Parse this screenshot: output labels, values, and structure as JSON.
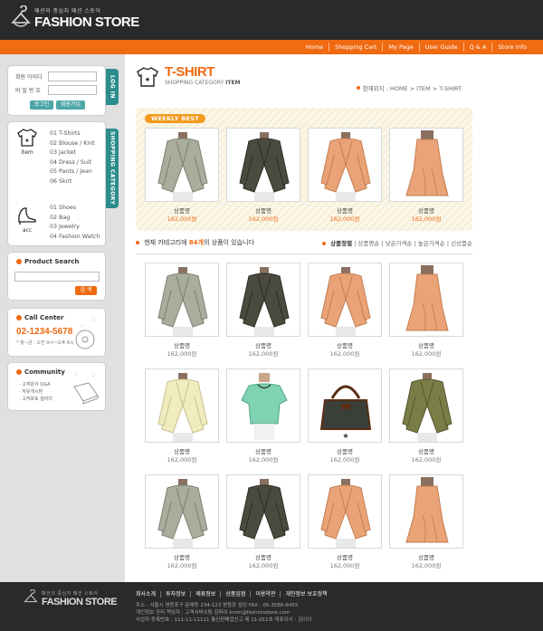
{
  "header": {
    "logo_sub": "패션의 중심지 패션 스토어",
    "logo_main": "FASHION STORE",
    "nav": [
      "Home",
      "Shopping Cart",
      "My Page",
      "User Guide",
      "Q & A",
      "Store Info"
    ]
  },
  "login": {
    "id_label": "회원 아이디",
    "pw_label": "비 밀 번 호",
    "login_button": "로그인",
    "join_button": "회원가입",
    "tab_label": "LOG IN"
  },
  "category": {
    "tab_label": "SHOPPING CATEGORY",
    "item_label": "item",
    "acc_label": "acc",
    "items": [
      "01 T-Shirts",
      "02 Blouse / Knit",
      "03 Jacket",
      "04 Dress / Suit",
      "05 Pants / Jean",
      "06 Skirt"
    ],
    "acc": [
      "01 Shoes",
      "02 Bag",
      "03 Jewelry",
      "04 Fashion Watch"
    ]
  },
  "search": {
    "title": "Product Search",
    "button": "검 색"
  },
  "call": {
    "title": "Call Center",
    "number": "02-1234-5678",
    "hours": "* 월~금 : 오전 9시~오후 6시"
  },
  "community": {
    "title": "Community",
    "items": [
      "고객문의 Q&A",
      "자유게시판",
      "고객포토 갤러리"
    ]
  },
  "page": {
    "title": "T-SHIRT",
    "subtitle_a": "SHOPPING CATEGORY",
    "subtitle_b": "ITEM",
    "breadcrumb": "현재위치 : HOME > ITEM > T-SHIRT"
  },
  "weekly": {
    "label": "WEEKLY BEST",
    "products": [
      {
        "name": "상품명",
        "price": "162,000원",
        "type": "jacket-grey"
      },
      {
        "name": "상품명",
        "price": "162,000원",
        "type": "jacket-dark"
      },
      {
        "name": "상품명",
        "price": "162,000원",
        "type": "jacket-orange"
      },
      {
        "name": "상품명",
        "price": "162,000원",
        "type": "skirt"
      }
    ]
  },
  "listing": {
    "prefix": "현재 카테고리에",
    "count": "84개",
    "suffix": "의 상품이 있습니다",
    "sort_label": "상품정렬",
    "sort_options": "상품명순 | 낮은가격순 | 높은가격순 | 신상품순"
  },
  "products": [
    {
      "name": "상품명",
      "price": "162,000원",
      "type": "jacket-grey"
    },
    {
      "name": "상품명",
      "price": "162,000원",
      "type": "jacket-dark"
    },
    {
      "name": "상품명",
      "price": "162,000원",
      "type": "jacket-orange"
    },
    {
      "name": "상품명",
      "price": "162,000원",
      "type": "skirt"
    },
    {
      "name": "상품명",
      "price": "162,000원",
      "type": "jacket-cream"
    },
    {
      "name": "상품명",
      "price": "162,000원",
      "type": "tee-green"
    },
    {
      "name": "상품명",
      "price": "162,000원",
      "type": "bag"
    },
    {
      "name": "상품명",
      "price": "162,000원",
      "type": "jacket-olive"
    },
    {
      "name": "상품명",
      "price": "162,000원",
      "type": "jacket-grey"
    },
    {
      "name": "상품명",
      "price": "162,000원",
      "type": "jacket-dark"
    },
    {
      "name": "상품명",
      "price": "162,000원",
      "type": "jacket-orange"
    },
    {
      "name": "상품명",
      "price": "162,000원",
      "type": "skirt"
    }
  ],
  "footer": {
    "logo_sub": "패션의 중심지 패션 스토어",
    "logo_main": "FASHION STORE",
    "links": [
      "회사소개",
      "투자정보",
      "제휴정보",
      "상품입점",
      "이용약관",
      "개인정보 보호정책"
    ],
    "info": [
      "주소 : 서울시 영등포구 문래동 234-123 영등포 빌딩   FAX : 05-3586-6455",
      "개인정보 관리 책임자 : 고객서비스팀 김파이   kmm@fashionstore.com",
      "사업자 등록번호 : 111-11-11111 통신판매업신고 제 11-011호   대표이사 : 김이이"
    ]
  }
}
